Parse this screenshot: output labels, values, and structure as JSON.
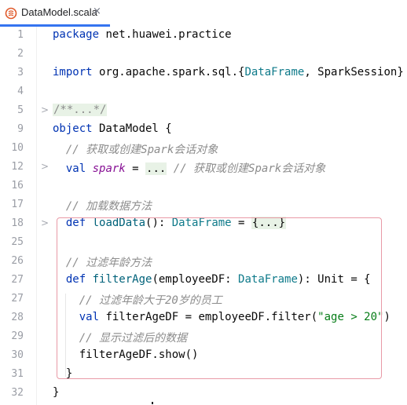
{
  "tab": {
    "title": "DataModel.scala",
    "close": "×",
    "icon": "scala-file-icon"
  },
  "lines": [
    {
      "n": "1",
      "parts": [
        {
          "t": "package",
          "c": "kw"
        },
        {
          "t": " net.huawei.practice",
          "c": "pn"
        }
      ]
    },
    {
      "n": "2",
      "parts": []
    },
    {
      "n": "3",
      "parts": [
        {
          "t": "import",
          "c": "kw"
        },
        {
          "t": " org.apache.spark.sql.{",
          "c": "pn"
        },
        {
          "t": "DataFrame",
          "c": "ty"
        },
        {
          "t": ", SparkSession}",
          "c": "pn"
        }
      ]
    },
    {
      "n": "4",
      "parts": []
    },
    {
      "n": "5",
      "fold": ">",
      "parts": [
        {
          "t": "/**...*/",
          "c": "fold-ph fold-ph-gray"
        }
      ]
    },
    {
      "n": "9",
      "parts": [
        {
          "t": "object",
          "c": "kw"
        },
        {
          "t": " DataModel {",
          "c": "pn"
        }
      ]
    },
    {
      "n": "10",
      "parts": [
        {
          "t": "  // 获取或创建Spark会话对象",
          "c": "cm"
        }
      ]
    },
    {
      "n": "12",
      "fold": ">",
      "parts": [
        {
          "t": "  ",
          "c": "pn"
        },
        {
          "t": "val",
          "c": "kw"
        },
        {
          "t": " ",
          "c": "pn"
        },
        {
          "t": "spark",
          "c": "vr"
        },
        {
          "t": " = ",
          "c": "pn"
        },
        {
          "t": "...",
          "c": "fold-ph"
        },
        {
          "t": " // 获取或创建Spark会话对象",
          "c": "cm"
        }
      ]
    },
    {
      "n": "16",
      "parts": []
    },
    {
      "n": "17",
      "parts": [
        {
          "t": "  // 加载数据方法",
          "c": "cm"
        }
      ]
    },
    {
      "n": "18",
      "fold": ">",
      "parts": [
        {
          "t": "  ",
          "c": "pn"
        },
        {
          "t": "def",
          "c": "kw"
        },
        {
          "t": " ",
          "c": "pn"
        },
        {
          "t": "loadData",
          "c": "fn"
        },
        {
          "t": "(): ",
          "c": "pn"
        },
        {
          "t": "DataFrame",
          "c": "ty"
        },
        {
          "t": " = ",
          "c": "pn"
        },
        {
          "t": "{...}",
          "c": "fold-ph"
        }
      ]
    },
    {
      "n": "25",
      "parts": []
    },
    {
      "n": "26",
      "parts": [
        {
          "t": "  // 过滤年龄方法",
          "c": "cm"
        }
      ]
    },
    {
      "n": "27",
      "parts": [
        {
          "t": "  ",
          "c": "pn"
        },
        {
          "t": "def",
          "c": "kw"
        },
        {
          "t": " ",
          "c": "pn"
        },
        {
          "t": "filterAge",
          "c": "fn"
        },
        {
          "t": "(employeeDF: ",
          "c": "pn"
        },
        {
          "t": "DataFrame",
          "c": "ty"
        },
        {
          "t": "): Unit = {",
          "c": "pn"
        }
      ]
    },
    {
      "n": "27",
      "parts": [
        {
          "t": "    // 过滤年龄大于20岁的员工",
          "c": "cm"
        }
      ]
    },
    {
      "n": "28",
      "parts": [
        {
          "t": "    ",
          "c": "pn"
        },
        {
          "t": "val",
          "c": "kw"
        },
        {
          "t": " filterAgeDF = employeeDF.filter(",
          "c": "pn"
        },
        {
          "t": "\"age > 20\"",
          "c": "st"
        },
        {
          "t": ")",
          "c": "pn"
        }
      ]
    },
    {
      "n": "29",
      "parts": [
        {
          "t": "    // 显示过滤后的数据",
          "c": "cm"
        }
      ]
    },
    {
      "n": "30",
      "parts": [
        {
          "t": "    filterAgeDF.show()",
          "c": "pn"
        }
      ]
    },
    {
      "n": "31",
      "parts": [
        {
          "t": "  }",
          "c": "pn"
        }
      ]
    },
    {
      "n": "32",
      "parts": [
        {
          "t": "}",
          "c": "pn"
        }
      ]
    }
  ]
}
